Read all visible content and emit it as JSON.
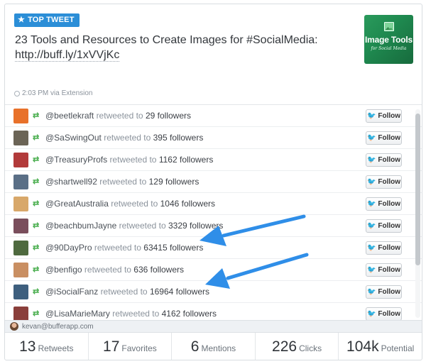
{
  "badge": {
    "label": "TOP TWEET",
    "icon": "star-icon"
  },
  "tweet": {
    "text": "23 Tools and Resources to Create Images for #SocialMedia:",
    "link": "http://buff.ly/1xVVjKc"
  },
  "thumbnail": {
    "title": "Image Tools",
    "subtitle": "for Social Media"
  },
  "meta": {
    "time_source": "2:03 PM via Extension"
  },
  "retweet_mid": "retweeted to",
  "followers_label": "followers",
  "follow_label": "Follow",
  "retweeters": [
    {
      "handle": "@beetlekraft",
      "count": "29",
      "avatar_color": "#e8712a"
    },
    {
      "handle": "@SaSwingOut",
      "count": "395",
      "avatar_color": "#6b6456"
    },
    {
      "handle": "@TreasuryProfs",
      "count": "1162",
      "avatar_color": "#b23a3a"
    },
    {
      "handle": "@shartwell92",
      "count": "129",
      "avatar_color": "#5a6f86"
    },
    {
      "handle": "@GreatAustralia",
      "count": "1046",
      "avatar_color": "#d8a86a"
    },
    {
      "handle": "@beachbumJayne",
      "count": "3329",
      "avatar_color": "#7a4e5c"
    },
    {
      "handle": "@90DayPro",
      "count": "63415",
      "avatar_color": "#4f6a3f"
    },
    {
      "handle": "@benfigo",
      "count": "636",
      "avatar_color": "#c98f62"
    },
    {
      "handle": "@iSocialFanz",
      "count": "16964",
      "avatar_color": "#3e5f7e"
    },
    {
      "handle": "@LisaMarieMary",
      "count": "4162",
      "avatar_color": "#8a3f3b"
    }
  ],
  "user": {
    "email": "kevan@bufferapp.com"
  },
  "stats": [
    {
      "num": "13",
      "label": "Retweets"
    },
    {
      "num": "17",
      "label": "Favorites"
    },
    {
      "num": "6",
      "label": "Mentions"
    },
    {
      "num": "226",
      "label": "Clicks"
    },
    {
      "num": "104k",
      "label": "Potential"
    }
  ],
  "colors": {
    "accent": "#2b8ed7",
    "retweet": "#4caf50",
    "arrow": "#2f8ee8"
  }
}
